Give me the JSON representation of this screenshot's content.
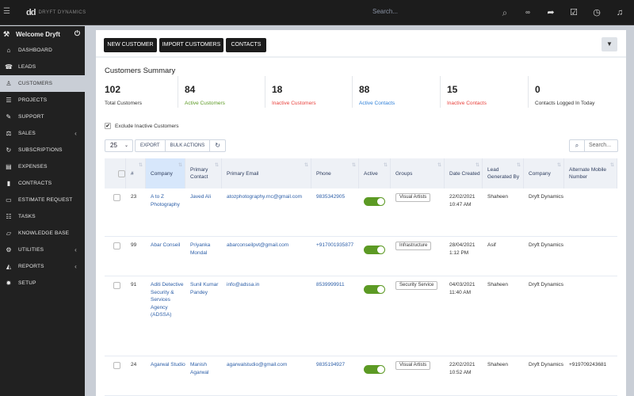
{
  "topbar": {
    "logo_mark": "dd",
    "brand_name": "DRYFT DYNAMICS",
    "search_placeholder": "Search...",
    "icons": [
      "search-icon",
      "infinity-icon",
      "share-icon",
      "checkbox-icon",
      "clock-icon",
      "bell-icon"
    ]
  },
  "sidebar": {
    "welcome": "Welcome Dryft",
    "items": [
      {
        "label": "DASHBOARD",
        "icon": "home-icon",
        "glyph": "⌂"
      },
      {
        "label": "LEADS",
        "icon": "tty-icon",
        "glyph": "☎"
      },
      {
        "label": "CUSTOMERS",
        "icon": "user-icon",
        "glyph": "♙",
        "active": true
      },
      {
        "label": "PROJECTS",
        "icon": "bars-icon",
        "glyph": "☰"
      },
      {
        "label": "SUPPORT",
        "icon": "ticket-icon",
        "glyph": "✎"
      },
      {
        "label": "SALES",
        "icon": "balance-scale-icon",
        "glyph": "⚖",
        "has_submenu": true
      },
      {
        "label": "SUBSCRIPTIONS",
        "icon": "refresh-icon",
        "glyph": "↻"
      },
      {
        "label": "EXPENSES",
        "icon": "file-text-icon",
        "glyph": "▤"
      },
      {
        "label": "CONTRACTS",
        "icon": "file-icon",
        "glyph": "▮"
      },
      {
        "label": "ESTIMATE REQUEST",
        "icon": "list-alt-icon",
        "glyph": "▭"
      },
      {
        "label": "TASKS",
        "icon": "tasks-icon",
        "glyph": "☷"
      },
      {
        "label": "KNOWLEDGE BASE",
        "icon": "folder-open-icon",
        "glyph": "▱"
      },
      {
        "label": "UTILITIES",
        "icon": "cogs-icon",
        "glyph": "⚙",
        "has_submenu": true
      },
      {
        "label": "REPORTS",
        "icon": "area-chart-icon",
        "glyph": "◭",
        "has_submenu": true
      },
      {
        "label": "SETUP",
        "icon": "cog-icon",
        "glyph": "✹"
      }
    ]
  },
  "toolbar": {
    "new_customer": "NEW CUSTOMER",
    "import_customers": "IMPORT CUSTOMERS",
    "contacts": "CONTACTS",
    "filter_icon": "▼"
  },
  "summary": {
    "title": "Customers Summary",
    "stats": [
      {
        "value": "102",
        "label": "Total Customers",
        "color": "#333333"
      },
      {
        "value": "84",
        "label": "Active Customers",
        "color": "#5c9a24"
      },
      {
        "value": "18",
        "label": "Inactive Customers",
        "color": "#e8413c"
      },
      {
        "value": "88",
        "label": "Active Contacts",
        "color": "#2f80d8"
      },
      {
        "value": "15",
        "label": "Inactive Contacts",
        "color": "#e8413c"
      },
      {
        "value": "0",
        "label": "Contacts Logged In Today",
        "color": "#333333"
      }
    ]
  },
  "filters": {
    "exclude_inactive_label": "Exclude Inactive Customers",
    "exclude_inactive_checked": true,
    "page_size": "25",
    "export_label": "EXPORT",
    "bulk_actions_label": "BULK ACTIONS",
    "search_placeholder": "Search..."
  },
  "table": {
    "columns": [
      "",
      "#",
      "Company",
      "Primary Contact",
      "Primary Email",
      "Phone",
      "Active",
      "Groups",
      "Date Created",
      "Lead Generated By",
      "Company",
      "Alternate Mobile Number"
    ],
    "sorted_column": "Company",
    "rows": [
      {
        "id": "23",
        "company": "A to Z Photography",
        "contact": "Javed Ali",
        "email": "atozphotography.rnc@gmail.com",
        "phone": "9835342905",
        "active": true,
        "group": "Visual Artists",
        "date": "22/02/2021",
        "time": "10:47 AM",
        "lead_by": "Shaheen",
        "company2": "Dryft Dynamics",
        "alt_mobile": ""
      },
      {
        "id": "99",
        "company": "Abar Conseil",
        "contact": "Priyanka Mondal",
        "email": "abarconseilpvt@gmail.com",
        "phone": "+917001935877",
        "active": true,
        "group": "Infrastructure",
        "date": "28/04/2021",
        "time": "1:12 PM",
        "lead_by": "Asif",
        "company2": "Dryft Dynamics",
        "alt_mobile": ""
      },
      {
        "id": "91",
        "company": "Aditi Detective Security & Services Agency (ADSSA)",
        "contact": "Sunil Kumar Pandey",
        "email": "info@adssa.in",
        "phone": "8539999911",
        "active": true,
        "group": "Security Service",
        "date": "04/03/2021",
        "time": "11:40 AM",
        "lead_by": "Shaheen",
        "company2": "Dryft Dynamics",
        "alt_mobile": ""
      },
      {
        "id": "24",
        "company": "Agarwal Studio",
        "contact": "Manish Agarwal",
        "email": "agarwalstudio@gmail.com",
        "phone": "9835194927",
        "active": true,
        "group": "Visual Artists",
        "date": "22/02/2021",
        "time": "10:52 AM",
        "lead_by": "Shaheen",
        "company2": "Dryft Dynamics",
        "alt_mobile": "+919709243681"
      }
    ]
  }
}
